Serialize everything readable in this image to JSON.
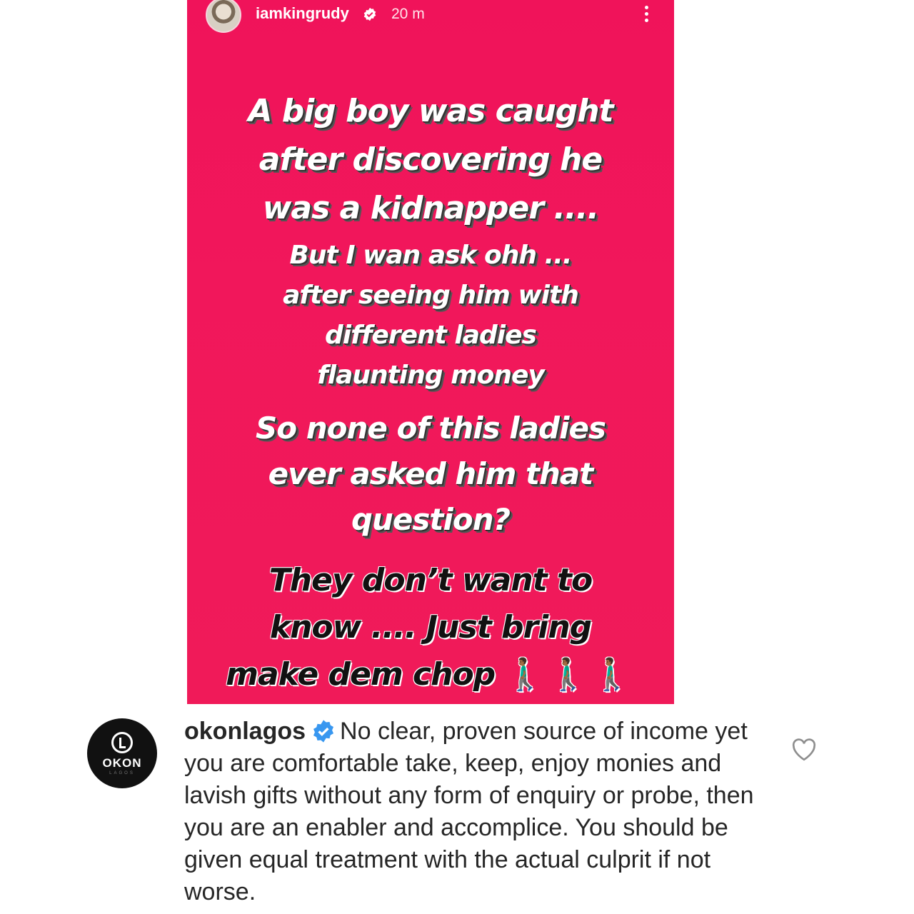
{
  "story": {
    "username": "iamkingrudy",
    "time": "20 m",
    "line_block_1": "A big boy was caught\nafter discovering he\nwas a kidnapper ....",
    "line_block_2": "But I wan ask ohh ...\nafter seeing him with\ndifferent ladies\nflaunting money",
    "line_block_3": "So none of this ladies\never asked him that\nquestion?",
    "line_block_4": "They don’t want to\nknow .... Just bring\nmake dem chop",
    "emoji_walkers": "🚶🏾‍♂️🚶🏾‍♂️🚶🏾‍♂️",
    "background_color": "#f0135a"
  },
  "comment": {
    "avatar_text": "OKON",
    "avatar_subtext": "LAGOS",
    "username": "okonlagos",
    "text": "No clear, proven source of income yet you are comfortable take, keep, enjoy monies and lavish gifts without any form of enquiry or probe, then you are an enabler and accomplice. You should be given equal treatment with the actual culprit if not worse."
  },
  "colors": {
    "verified": "#3897f0",
    "text": "#262626"
  }
}
